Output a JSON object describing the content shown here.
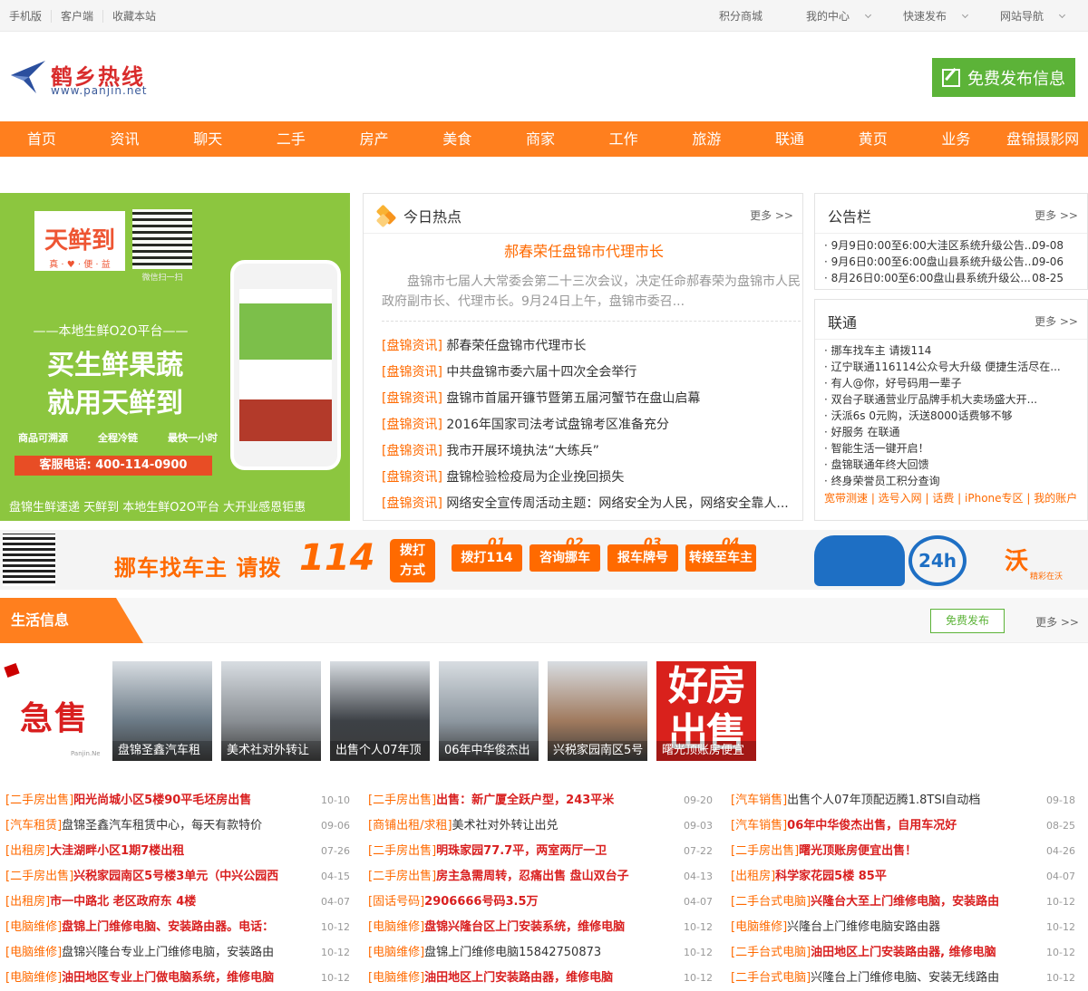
{
  "topbar": {
    "left": [
      "手机版",
      "客户端",
      "收藏本站"
    ],
    "right": [
      "积分商城",
      "我的中心",
      "快速发布",
      "网站导航"
    ]
  },
  "header": {
    "logo_text": "鹤乡热线",
    "logo_url": "www.panjin.net",
    "publish_label": "免费发布信息"
  },
  "nav": [
    "首页",
    "资讯",
    "聊天",
    "二手",
    "房产",
    "美食",
    "商家",
    "工作",
    "旅游",
    "联通",
    "黄页",
    "业务",
    "盘锦摄影网"
  ],
  "banner_ad": {
    "brand": "天鲜到",
    "brand_sub": "真 · ♥ · 便 · 益",
    "scan": "微信扫一扫",
    "slogan_small": "——本地生鲜O2O平台——",
    "slogan_big": [
      "买生鲜果蔬",
      "就用天鲜到"
    ],
    "features": [
      "商品可溯源",
      "全程冷链",
      "最快一小时"
    ],
    "phone_line": "客服电话: 400-114-0900",
    "caption": "盘锦生鲜速递 天鲜到 本地生鲜O2O平台 大开业感恩钜惠"
  },
  "hot": {
    "title": "今日热点",
    "more": "更多 >>",
    "headline": "郝春荣任盘锦市代理市长",
    "summary": "盘锦市七届人大常委会第二十三次会议，决定任命郝春荣为盘锦市人民政府副市长、代理市长。9月24日上午，盘锦市委召...",
    "items": [
      {
        "tag": "[盘锦资讯]",
        "title": "郝春荣任盘锦市代理市长"
      },
      {
        "tag": "[盘锦资讯]",
        "title": "中共盘锦市委六届十四次全会举行"
      },
      {
        "tag": "[盘锦资讯]",
        "title": "盘锦市首届开镰节暨第五届河蟹节在盘山启幕"
      },
      {
        "tag": "[盘锦资讯]",
        "title": "2016年国家司法考试盘锦考区准备充分"
      },
      {
        "tag": "[盘锦资讯]",
        "title": "我市开展环境执法“大练兵”"
      },
      {
        "tag": "[盘锦资讯]",
        "title": "盘锦检验检疫局为企业挽回损失"
      },
      {
        "tag": "[盘锦资讯]",
        "title": "网络安全宣传周活动主题：网络安全为人民，网络安全靠人..."
      }
    ]
  },
  "notice": {
    "title": "公告栏",
    "more": "更多 >>",
    "items": [
      {
        "title": "· 9月9日0:00至6:00大洼区系统升级公告...",
        "date": "09-08"
      },
      {
        "title": "· 9月6日0:00至6:00盘山县系统升级公告...",
        "date": "09-06"
      },
      {
        "title": "· 8月26日0:00至6:00盘山县系统升级公...",
        "date": "08-25"
      }
    ]
  },
  "unicom": {
    "title": "联通",
    "more": "更多 >>",
    "items": [
      "· 挪车找车主 请拨114",
      "· 辽宁联通116114公众号大升级 便捷生活尽在...",
      "· 有人@你，好号码用一辈子",
      "· 双台子联通营业厅品牌手机大卖场盛大开...",
      "· 沃派6s 0元购，沃送8000话费够不够",
      "· 好服务 在联通",
      "· 智能生活一键开启！",
      "· 盘锦联通年终大回馈",
      "· 终身荣誉员工积分查询"
    ],
    "links": "宽带测速 | 选号入网 | 话费 | iPhone专区 | 我的账户"
  },
  "banner2": {
    "tagline": "挪车找车主 请拨",
    "big": "114",
    "method": [
      "拨打",
      "方式"
    ],
    "steps": [
      {
        "num": "01",
        "label": "拨打114"
      },
      {
        "num": "02",
        "label": "咨询挪车"
      },
      {
        "num": "03",
        "label": "报车牌号"
      },
      {
        "num": "04",
        "label": "转接至车主"
      }
    ],
    "badge": "24h",
    "brand": "沃",
    "brand_sub": "精彩在沃"
  },
  "life": {
    "title": "生活信息",
    "free_label": "免费发布",
    "more": "更多 >>",
    "urgent": "急售",
    "urgent_mark": "Panjin.Net",
    "good_house": [
      "好房",
      "出售"
    ],
    "thumbs": [
      {
        "caption": "盘锦圣鑫汽车租",
        "color": "#6b7a86"
      },
      {
        "caption": "美术社对外转让",
        "color": "#8a8f94"
      },
      {
        "caption": "出售个人07年顶",
        "color": "#3d4146"
      },
      {
        "caption": "06年中华俊杰出",
        "color": "#8d97a0"
      },
      {
        "caption": "兴税家园南区5号",
        "color": "#a07a5e"
      },
      {
        "caption": "曙光顶账房便宜",
        "color": "#d9211c"
      }
    ]
  },
  "lists": [
    [
      {
        "tag": "[二手房出售]",
        "title": "阳光尚城小区5楼90平毛坯房出售",
        "date": "10-10",
        "red": true
      },
      {
        "tag": "[汽车租赁]",
        "title": "盘锦圣鑫汽车租赁中心，每天有款特价",
        "date": "09-06",
        "red": false
      },
      {
        "tag": "[出租房]",
        "title": "大洼湖畔小区1期7楼出租",
        "date": "07-26",
        "red": true
      },
      {
        "tag": "[二手房出售]",
        "title": "兴税家园南区5号楼3单元（中兴公园西",
        "date": "04-15",
        "red": true
      },
      {
        "tag": "[出租房]",
        "title": "市一中路北 老区政府东 4楼",
        "date": "04-07",
        "red": true
      },
      {
        "tag": "[电脑维修]",
        "title": "盘锦上门维修电脑、安装路由器。电话：",
        "date": "10-12",
        "red": true
      },
      {
        "tag": "[电脑维修]",
        "title": "盘锦兴隆台专业上门维修电脑，安装路由",
        "date": "10-12",
        "red": false
      },
      {
        "tag": "[电脑维修]",
        "title": "油田地区专业上门做电脑系统，维修电脑",
        "date": "10-12",
        "red": true
      }
    ],
    [
      {
        "tag": "[二手房出售]",
        "title": "出售：新广厦全跃户型，243平米",
        "date": "09-20",
        "red": true
      },
      {
        "tag": "[商铺出租/求租]",
        "title": "美术社对外转让出兑",
        "date": "09-03",
        "red": false
      },
      {
        "tag": "[二手房出售]",
        "title": "明珠家园77.7平，两室两厅一卫",
        "date": "07-22",
        "red": true
      },
      {
        "tag": "[二手房出售]",
        "title": "房主急需周转，忍痛出售 盘山双台子",
        "date": "04-13",
        "red": true
      },
      {
        "tag": "[固话号码]",
        "title": "2906666号码3.5万",
        "date": "04-07",
        "red": true
      },
      {
        "tag": "[电脑维修]",
        "title": "盘锦兴隆台区上门安装系统，维修电脑",
        "date": "10-12",
        "red": true
      },
      {
        "tag": "[电脑维修]",
        "title": "盘锦上门维修电脑15842750873",
        "date": "10-12",
        "red": false
      },
      {
        "tag": "[电脑维修]",
        "title": "油田地区上门安装路由器，维修电脑",
        "date": "10-12",
        "red": true
      }
    ],
    [
      {
        "tag": "[汽车销售]",
        "title": "出售个人07年顶配迈腾1.8TSI自动档",
        "date": "09-18",
        "red": false
      },
      {
        "tag": "[汽车销售]",
        "title": "06年中华俊杰出售，自用车况好",
        "date": "08-25",
        "red": true
      },
      {
        "tag": "[二手房出售]",
        "title": "曙光顶账房便宜出售！",
        "date": "04-26",
        "red": true
      },
      {
        "tag": "[出租房]",
        "title": "科学家花园5楼 85平",
        "date": "04-07",
        "red": true
      },
      {
        "tag": "[二手台式电脑]",
        "title": "兴隆台大至上门维修电脑，安装路由",
        "date": "10-12",
        "red": true
      },
      {
        "tag": "[电脑维修]",
        "title": "兴隆台上门维修电脑安路由器",
        "date": "10-12",
        "red": false
      },
      {
        "tag": "[二手台式电脑]",
        "title": "油田地区上门安装路由器, 维修电脑",
        "date": "10-12",
        "red": true
      },
      {
        "tag": "[二手台式电脑]",
        "title": "兴隆台上门维修电脑、安装无线路由",
        "date": "10-12",
        "red": false
      }
    ]
  ]
}
